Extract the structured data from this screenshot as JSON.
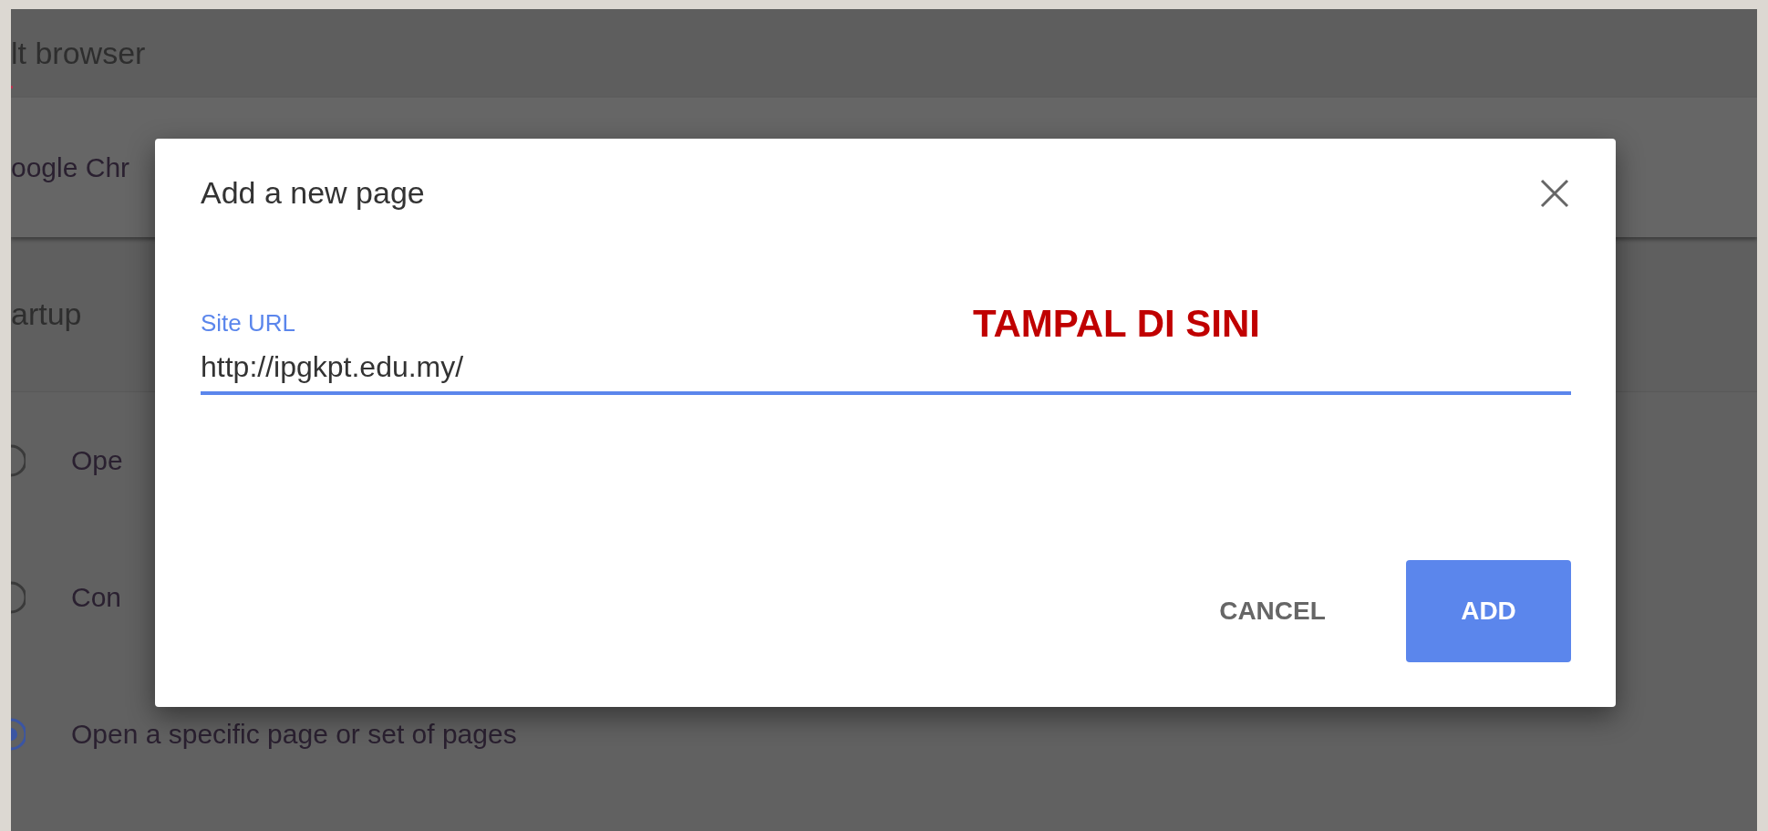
{
  "settings": {
    "header": "lt browser",
    "default_browser_row": "oogle Chr",
    "section_title": "artup",
    "startup_options": [
      {
        "label": "Ope",
        "selected": false
      },
      {
        "label": "Con",
        "selected": false
      },
      {
        "label": "Open a specific page or set of pages",
        "selected": true
      }
    ]
  },
  "dialog": {
    "title": "Add a new page",
    "field": {
      "label": "Site URL",
      "value": "http://ipgkpt.edu.my/"
    },
    "annotation": "TAMPAL DI SINI",
    "buttons": [
      {
        "label": "CANCEL",
        "kind": "text"
      },
      {
        "label": "ADD",
        "kind": "primary"
      }
    ]
  }
}
